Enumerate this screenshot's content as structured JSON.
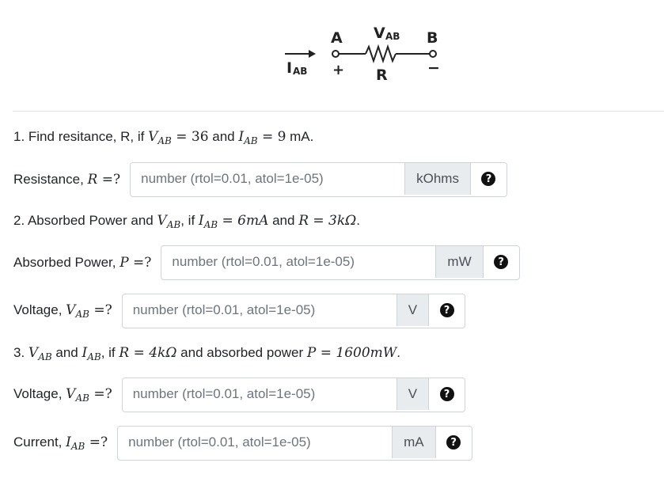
{
  "circuit": {
    "node_a": "A",
    "node_b": "B",
    "v_label": "V",
    "v_sub": "AB",
    "i_label": "I",
    "i_sub": "AB",
    "plus": "+",
    "minus": "−",
    "r_label": "R"
  },
  "q1": {
    "t1": "1. Find resitance, R, if ",
    "v": "V",
    "vsub": "AB",
    "eq1": " = 36",
    "t2": " and ",
    "i": "I",
    "isub": "AB",
    "eq2": " = 9",
    "t3": " mA."
  },
  "q2": {
    "t1": "2. Absorbed Power and ",
    "v": "V",
    "vsub": "AB",
    "t2": ", if ",
    "i": "I",
    "isub": "AB",
    "eq": " = 6mA",
    "t3": " and ",
    "r": "R",
    "eq2": " = 3kΩ",
    "t4": "."
  },
  "q3": {
    "num": "3. ",
    "v": "V",
    "vsub": "AB",
    "t1": " and ",
    "i": "I",
    "isub": "AB",
    "t2": ", if ",
    "r": "R",
    "eq": " = 4kΩ",
    "t3": " and absorbed power ",
    "p": "P",
    "eq2": " = 1600mW",
    "t4": "."
  },
  "fields": {
    "resistance": {
      "prefix": "Resistance, ",
      "sym": "R",
      "suffix": " =?",
      "placeholder": "number (rtol=0.01, atol=1e-05)",
      "unit": "kOhms"
    },
    "power": {
      "prefix": "Absorbed Power, ",
      "sym": "P",
      "suffix": " =?",
      "placeholder": "number (rtol=0.01, atol=1e-05)",
      "unit": "mW"
    },
    "voltage2": {
      "prefix": "Voltage, ",
      "sym": "V",
      "sub": "AB",
      "suffix": " =?",
      "placeholder": "number (rtol=0.01, atol=1e-05)",
      "unit": "V"
    },
    "voltage3": {
      "prefix": "Voltage, ",
      "sym": "V",
      "sub": "AB",
      "suffix": " =?",
      "placeholder": "number (rtol=0.01, atol=1e-05)",
      "unit": "V"
    },
    "current3": {
      "prefix": "Current, ",
      "sym": "I",
      "sub": "AB",
      "suffix": " =?",
      "placeholder": "number (rtol=0.01, atol=1e-05)",
      "unit": "mA"
    }
  },
  "help_glyph": "?"
}
